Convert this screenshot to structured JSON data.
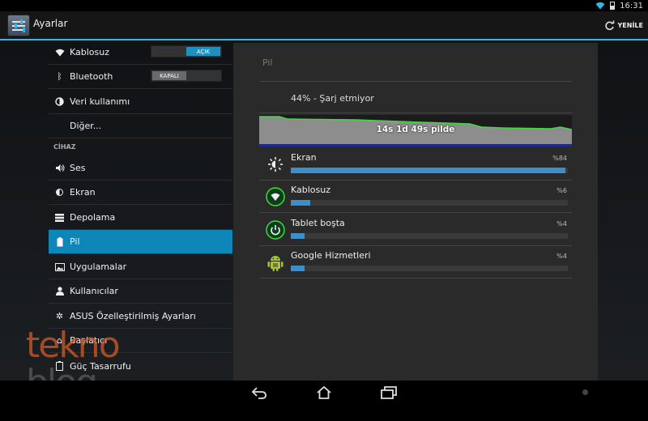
{
  "status_bar": {
    "time": "16:31"
  },
  "action_bar": {
    "title": "Ayarlar",
    "refresh_label": "YENİLE"
  },
  "left_list": {
    "kablosuz": {
      "label": "Kablosuz",
      "toggle": "AÇIK"
    },
    "bluetooth": {
      "label": "Bluetooth",
      "toggle": "KAPALI"
    },
    "veri": {
      "label": "Veri kullanımı"
    },
    "diger": {
      "label": "Diğer..."
    },
    "section_device": "CİHAZ",
    "ses": {
      "label": "Ses"
    },
    "ekran": {
      "label": "Ekran"
    },
    "depolama": {
      "label": "Depolama"
    },
    "pil": {
      "label": "Pil"
    },
    "uygulamalar": {
      "label": "Uygulamalar"
    },
    "kullanicilar": {
      "label": "Kullanıcılar"
    },
    "asus": {
      "label": "ASUS Özelleştirilmiş Ayarları"
    },
    "baslatici": {
      "label": "Başlatıcı"
    },
    "guc": {
      "label": "Güç Tasarrufu"
    }
  },
  "battery": {
    "title": "Pil",
    "status": "44% - Şarj etmiyor",
    "graph_label": "14s 1d 49s pilde",
    "usage": [
      {
        "name": "Ekran",
        "percent_label": "%84",
        "fraction": 0.99
      },
      {
        "name": "Kablosuz",
        "percent_label": "%6",
        "fraction": 0.07
      },
      {
        "name": "Tablet boşta",
        "percent_label": "%4",
        "fraction": 0.05
      },
      {
        "name": "Google Hizmetleri",
        "percent_label": "%4",
        "fraction": 0.05
      }
    ]
  },
  "watermark": {
    "line1": "tekno",
    "line2": "blog"
  },
  "colors": {
    "accent": "#33b5e5",
    "selected": "#0f86b8",
    "bar": "#3d8fcb",
    "graph_line": "#3ddc3d"
  },
  "icons": {
    "nav": [
      "back-icon",
      "home-icon",
      "recent-apps-icon"
    ],
    "status": [
      "wifi-icon",
      "battery-icon"
    ]
  }
}
